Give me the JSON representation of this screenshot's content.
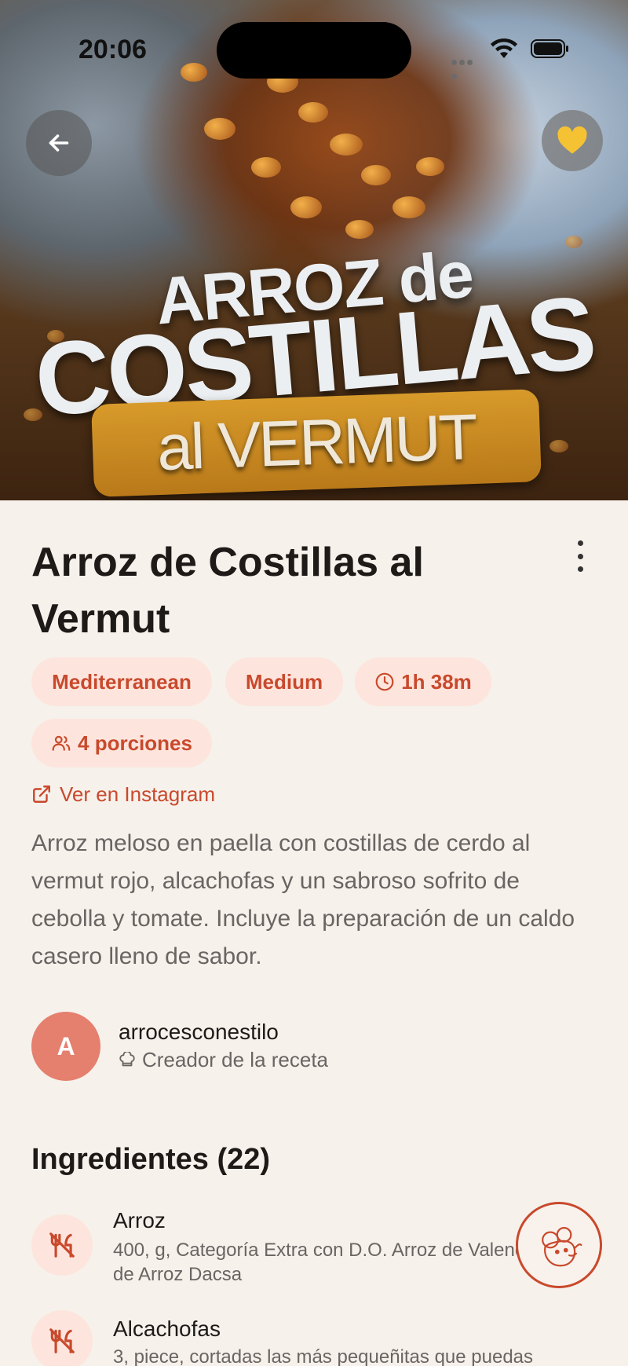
{
  "status_bar": {
    "time": "20:06"
  },
  "hero": {
    "overlay_line1": "ARROZ de",
    "overlay_line2": "COSTILLAS",
    "overlay_line3": "al VERMUT"
  },
  "recipe": {
    "title": "Arroz de Costillas al Vermut",
    "tags": {
      "cuisine": "Mediterranean",
      "difficulty": "Medium",
      "time": "1h 38m",
      "servings": "4 porciones"
    },
    "instagram_link": "Ver en Instagram",
    "description": "Arroz meloso en paella con costillas de cerdo al vermut rojo, alcachofas y un sabroso sofrito de cebolla y tomate. Incluye la preparación de un caldo casero lleno de sabor."
  },
  "author": {
    "initial": "A",
    "username": "arrocesconestilo",
    "role": "Creador de la receta"
  },
  "ingredients": {
    "heading": "Ingredientes (22)",
    "items": [
      {
        "name": "Arroz",
        "detail_line1": "400, g, Categoría Extra con D.O. Arroz de Valencia o",
        "detail_line2": "de Arroz Dacsa"
      },
      {
        "name": "Alcachofas",
        "detail_line1": "3, piece, cortadas las más pequeñitas que puedas",
        "detail_line2": ""
      }
    ]
  },
  "icons": {
    "back": "arrow-left-icon",
    "favorite": "heart-icon",
    "more": "more-vertical-icon",
    "time": "clock-icon",
    "servings": "users-icon",
    "external": "external-link-icon",
    "chef": "chef-hat-icon",
    "ingredient": "utensils-icon",
    "assistant": "mouse-chef-icon"
  },
  "colors": {
    "accent": "#c9492c",
    "chip_bg": "#fde5dd",
    "background": "#f6f1eb",
    "avatar": "#e57f6e",
    "favorite": "#f5c233"
  }
}
